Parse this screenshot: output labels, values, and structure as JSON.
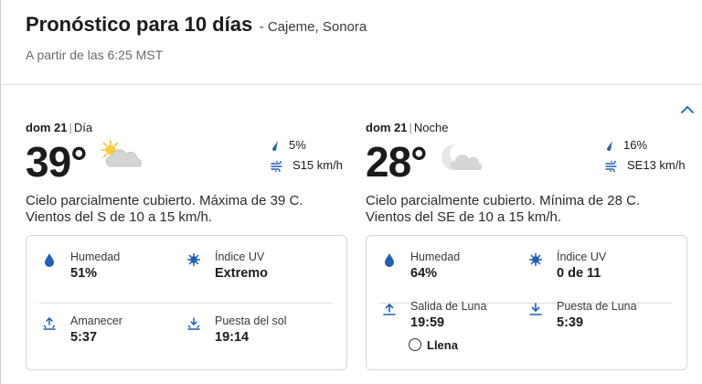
{
  "header": {
    "title": "Pronóstico para 10 días",
    "location": "- Cajeme, Sonora",
    "as_of": "A partir de las 6:25 MST"
  },
  "day": {
    "date": "dom 21",
    "period": "Día",
    "temp": "39°",
    "icon": "partly-cloudy-day-icon",
    "precip": "5%",
    "wind": "S15 km/h",
    "description": "Cielo parcialmente cubierto. Máxima de 39 C. Vientos del S de 10 a 15 km/h.",
    "details": {
      "humidity_label": "Humedad",
      "humidity_value": "51%",
      "uv_label": "Índice UV",
      "uv_value": "Extremo",
      "sunrise_label": "Amanecer",
      "sunrise_value": "5:37",
      "sunset_label": "Puesta del sol",
      "sunset_value": "19:14"
    }
  },
  "night": {
    "date": "dom 21",
    "period": "Noche",
    "temp": "28°",
    "icon": "partly-cloudy-night-icon",
    "precip": "16%",
    "wind": "SE13 km/h",
    "description": "Cielo parcialmente cubierto. Mínima de 28 C. Vientos del SE de 10 a 15 km/h.",
    "details": {
      "humidity_label": "Humedad",
      "humidity_value": "64%",
      "uv_label": "Índice UV",
      "uv_value": "0 de 11",
      "moonrise_label": "Salida de Luna",
      "moonrise_value": "19:59",
      "moonset_label": "Puesta de Luna",
      "moonset_value": "5:39",
      "moon_phase": "Llena"
    }
  },
  "colors": {
    "accent": "#1f5fb5",
    "sun": "#f2c12e",
    "cloud": "#c9c9c9"
  }
}
